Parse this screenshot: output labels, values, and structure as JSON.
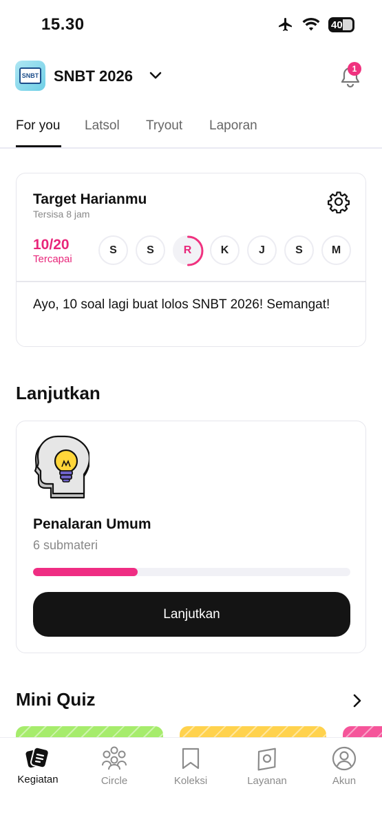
{
  "status_bar": {
    "time": "15.30",
    "battery": "40"
  },
  "header": {
    "app_title": "SNBT 2026",
    "logo_text": "SNBT",
    "notification_count": "1"
  },
  "tabs": [
    {
      "label": "For you",
      "active": true
    },
    {
      "label": "Latsol",
      "active": false
    },
    {
      "label": "Tryout",
      "active": false
    },
    {
      "label": "Laporan",
      "active": false
    }
  ],
  "daily_target": {
    "title": "Target Harianmu",
    "subtitle": "Tersisa 8 jam",
    "progress": "10/20",
    "progress_label": "Tercapai",
    "progress_fraction": 0.5,
    "days": [
      "S",
      "S",
      "R",
      "K",
      "J",
      "S",
      "M"
    ],
    "current_day_index": 2,
    "message": "Ayo, 10 soal lagi buat lolos SNBT 2026! Semangat!"
  },
  "continue_section": {
    "title": "Lanjutkan",
    "subject": "Penalaran Umum",
    "submateri": "6 submateri",
    "progress_fraction": 0.33,
    "button_label": "Lanjutkan",
    "icon": "lightbulb-head-icon"
  },
  "mini_quiz": {
    "title": "Mini Quiz",
    "card_colors": [
      "#a6ec6c",
      "#ffd24d",
      "#f5559a"
    ]
  },
  "bottom_nav": [
    {
      "label": "Kegiatan",
      "icon": "kegiatan-icon",
      "active": true
    },
    {
      "label": "Circle",
      "icon": "circle-people-icon",
      "active": false
    },
    {
      "label": "Koleksi",
      "icon": "bookmark-icon",
      "active": false
    },
    {
      "label": "Layanan",
      "icon": "layanan-icon",
      "active": false
    },
    {
      "label": "Akun",
      "icon": "account-icon",
      "active": false
    }
  ],
  "colors": {
    "accent": "#e8267a",
    "progress_bar": "#ef2d83",
    "button": "#141414"
  }
}
